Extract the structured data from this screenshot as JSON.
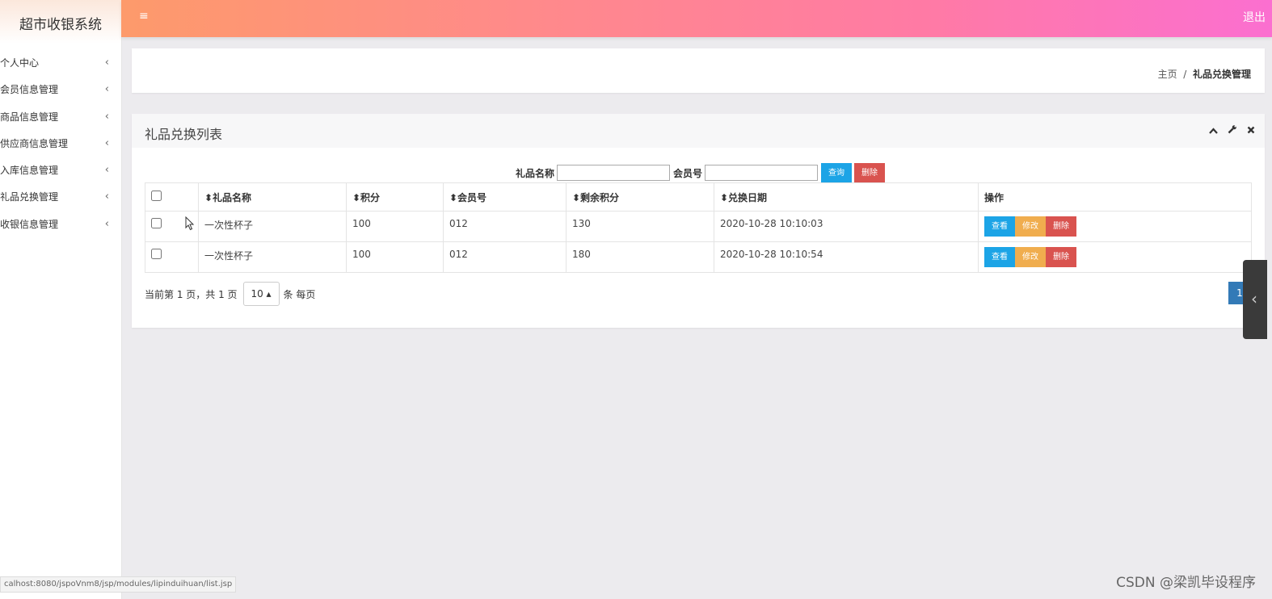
{
  "sidebar": {
    "title": "超市收银系统",
    "items": [
      {
        "label": "个人中心"
      },
      {
        "label": "会员信息管理"
      },
      {
        "label": "商品信息管理"
      },
      {
        "label": "供应商信息管理"
      },
      {
        "label": "入库信息管理"
      },
      {
        "label": "礼品兑换管理"
      },
      {
        "label": "收银信息管理"
      }
    ],
    "arrow": "‹"
  },
  "topbar": {
    "menu_icon": "≡",
    "logout": "退出"
  },
  "breadcrumb": {
    "home": "主页",
    "separator": "/",
    "current": "礼品兑换管理"
  },
  "panel": {
    "title": "礼品兑换列表",
    "tools": {
      "collapse": "⌃",
      "wrench": "🔧",
      "close": "✖"
    }
  },
  "search": {
    "gift_label": "礼品名称",
    "gift_value": "",
    "member_label": "会员号",
    "member_value": "",
    "query_button": "查询",
    "delete_button": "删除"
  },
  "table": {
    "columns": [
      "",
      "⬍礼品名称",
      "⬍积分",
      "⬍会员号",
      "⬍剩余积分",
      "⬍兑换日期",
      "操作"
    ],
    "rows": [
      {
        "gift": "一次性杯子",
        "points": "100",
        "member": "012",
        "remaining": "130",
        "date": "2020-10-28 10:10:03"
      },
      {
        "gift": "一次性杯子",
        "points": "100",
        "member": "012",
        "remaining": "180",
        "date": "2020-10-28 10:10:54"
      }
    ],
    "actions": {
      "view": "查看",
      "edit": "修改",
      "delete": "删除"
    }
  },
  "pager": {
    "info": "当前第 1 页，共 1 页",
    "page_size": "10 ▴",
    "per_page": "条 每页",
    "current_page": "1"
  },
  "statusbar": "calhost:8080/jspoVnm8/jsp/modules/lipinduihuan/list.jsp",
  "watermark": "CSDN @梁凯毕设程序"
}
